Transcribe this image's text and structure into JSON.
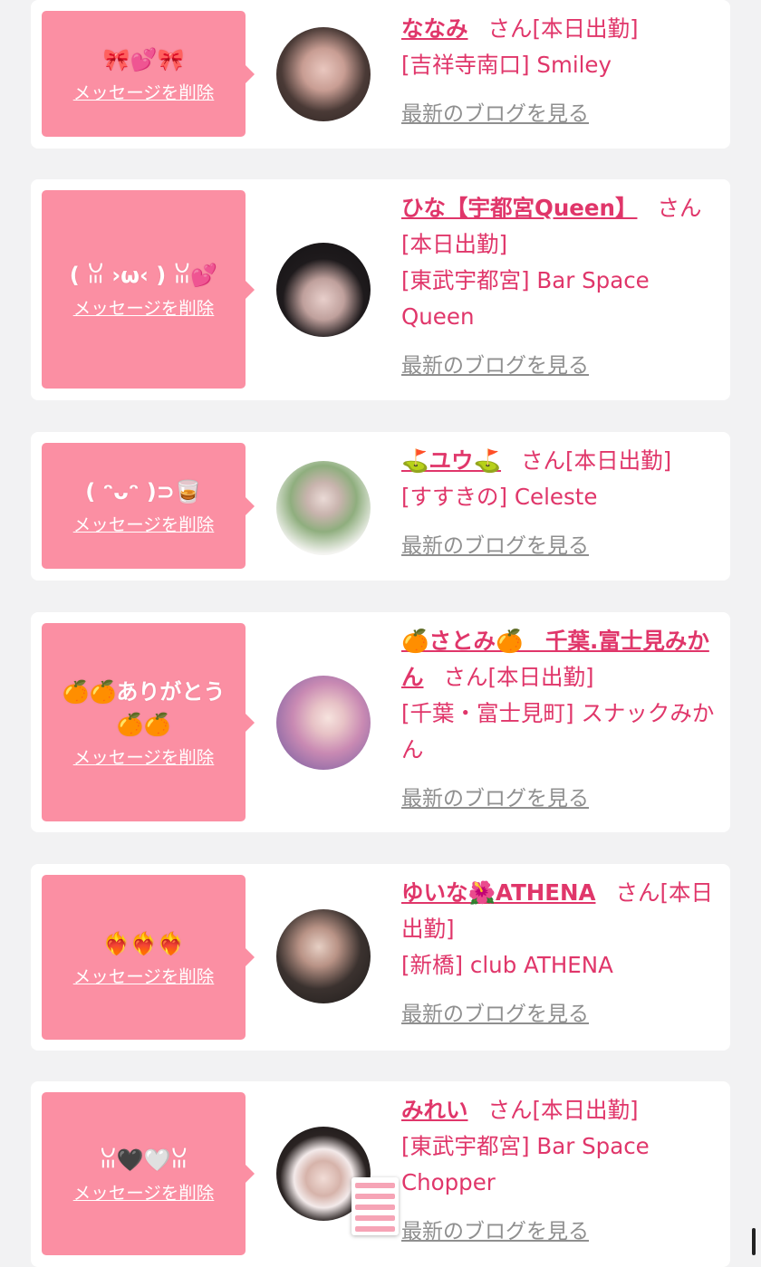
{
  "colors": {
    "accent": "#e0366a",
    "bubble": "#fb8fa3",
    "link_gray": "#8f8f8f"
  },
  "cards": [
    {
      "message": "🎀💕🎀",
      "delete_label": "メッセージを削除",
      "name": "ななみ",
      "san": "さん",
      "status": "[本日出勤]",
      "location": "[吉祥寺南口] Smiley",
      "blog_label": "最新のブログを見る"
    },
    {
      "message": "( ꈍ ›ω‹ ) ꈍ💕",
      "delete_label": "メッセージを削除",
      "name": "ひな【宇都宮Queen】",
      "san": "さん",
      "status": "[本日出勤]",
      "location": "[東武宇都宮] Bar Space Queen",
      "blog_label": "最新のブログを見る"
    },
    {
      "message": "( ᵔᴗᵔ )⊃🥃",
      "delete_label": "メッセージを削除",
      "name": "⛳ユウ⛳",
      "san": "さん",
      "status": "[本日出勤]",
      "location": "[すすきの] Celeste",
      "blog_label": "最新のブログを見る"
    },
    {
      "message": "🍊🍊ありがとう🍊🍊",
      "delete_label": "メッセージを削除",
      "name": "🍊さとみ🍊　千葉.富士見みかん",
      "san": "さん",
      "status": "[本日出勤]",
      "location": "[千葉・富士見町] スナックみかん",
      "blog_label": "最新のブログを見る"
    },
    {
      "message": "❤️‍🔥❤️‍🔥❤️‍🔥",
      "delete_label": "メッセージを削除",
      "name": "ゆいな🌺ATHENA",
      "san": "さん",
      "status": "[本日出勤]",
      "location": "[新橋] club ATHENA",
      "blog_label": "最新のブログを見る"
    },
    {
      "message": "ꈍ🖤🤍ꈍ",
      "delete_label": "メッセージを削除",
      "name": "みれい",
      "san": "さん",
      "status": "[本日出勤]",
      "location": "[東武宇都宮] Bar Space Chopper",
      "blog_label": "最新のブログを見る"
    }
  ]
}
